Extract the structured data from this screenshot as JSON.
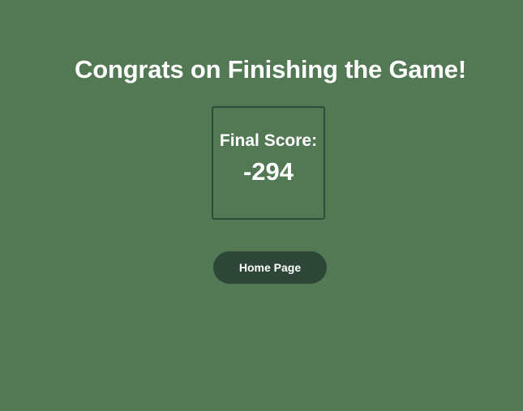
{
  "header": {
    "title": "Congrats on Finishing the Game!"
  },
  "score": {
    "label": "Final Score:",
    "value": "-294"
  },
  "actions": {
    "home_label": "Home Page"
  },
  "colors": {
    "background": "#527954",
    "button": "#2d4638",
    "card_border": "#2f4a37",
    "text": "#ffffff"
  }
}
